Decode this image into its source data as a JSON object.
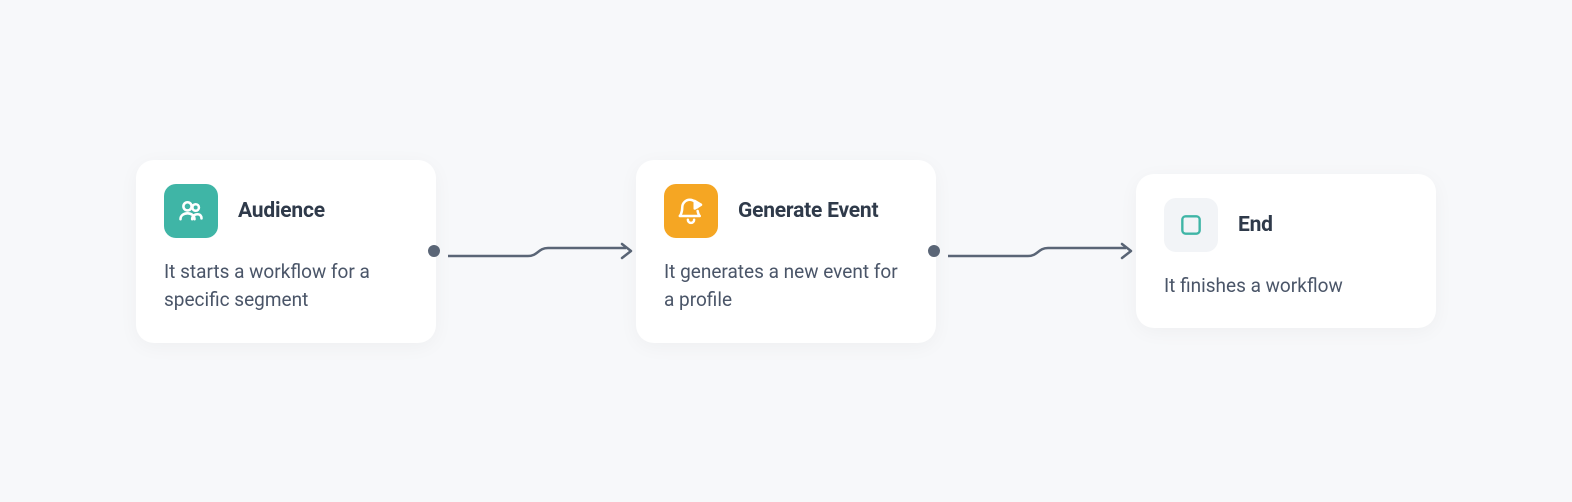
{
  "workflow": {
    "nodes": [
      {
        "id": "audience",
        "title": "Audience",
        "description": "It starts a workflow for a specific segment"
      },
      {
        "id": "generate-event",
        "title": "Generate Event",
        "description": "It generates a new event for a profile"
      },
      {
        "id": "end",
        "title": "End",
        "description": "It finishes a workflow"
      }
    ]
  },
  "colors": {
    "teal": "#3fb5a6",
    "orange": "#f5a623",
    "lightgray": "#f2f4f7",
    "connector": "#5a6576"
  }
}
